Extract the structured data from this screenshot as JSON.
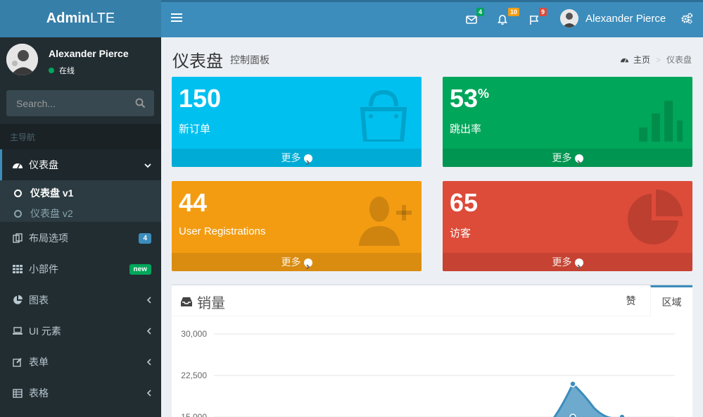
{
  "brand": {
    "bold": "Admin",
    "light": "LTE"
  },
  "navbar": {
    "messages_count": "4",
    "notifications_count": "10",
    "tasks_count": "9",
    "user_name": "Alexander Pierce"
  },
  "sidebar": {
    "user_name": "Alexander Pierce",
    "status": "在线",
    "search_placeholder": "Search...",
    "header": "主导航",
    "items": [
      {
        "label": "仪表盘"
      },
      {
        "label": "布局选项",
        "badge": "4"
      },
      {
        "label": "小部件",
        "badge": "new"
      },
      {
        "label": "图表"
      },
      {
        "label": "UI 元素"
      },
      {
        "label": "表单"
      },
      {
        "label": "表格"
      }
    ],
    "submenu": [
      {
        "label": "仪表盘 v1"
      },
      {
        "label": "仪表盘 v2"
      }
    ]
  },
  "content": {
    "title": "仪表盘",
    "subtitle": "控制面板",
    "breadcrumb_home": "主页",
    "breadcrumb_current": "仪表盘"
  },
  "boxes": [
    {
      "value": "150",
      "label": "新订单",
      "more": "更多",
      "color": "#00c0ef"
    },
    {
      "value": "53",
      "suffix": "%",
      "label": "跳出率",
      "more": "更多",
      "color": "#00a65a"
    },
    {
      "value": "44",
      "label": "User Registrations",
      "more": "更多",
      "color": "#f39c12"
    },
    {
      "value": "65",
      "label": "访客",
      "more": "更多",
      "color": "#dd4b39"
    }
  ],
  "sales": {
    "title": "销量",
    "tabs": [
      "赞",
      "区域"
    ]
  },
  "chart_data": {
    "type": "area",
    "y_ticks": [
      "30,000",
      "22,500",
      "15,000"
    ],
    "ylim": [
      15000,
      30000
    ]
  }
}
